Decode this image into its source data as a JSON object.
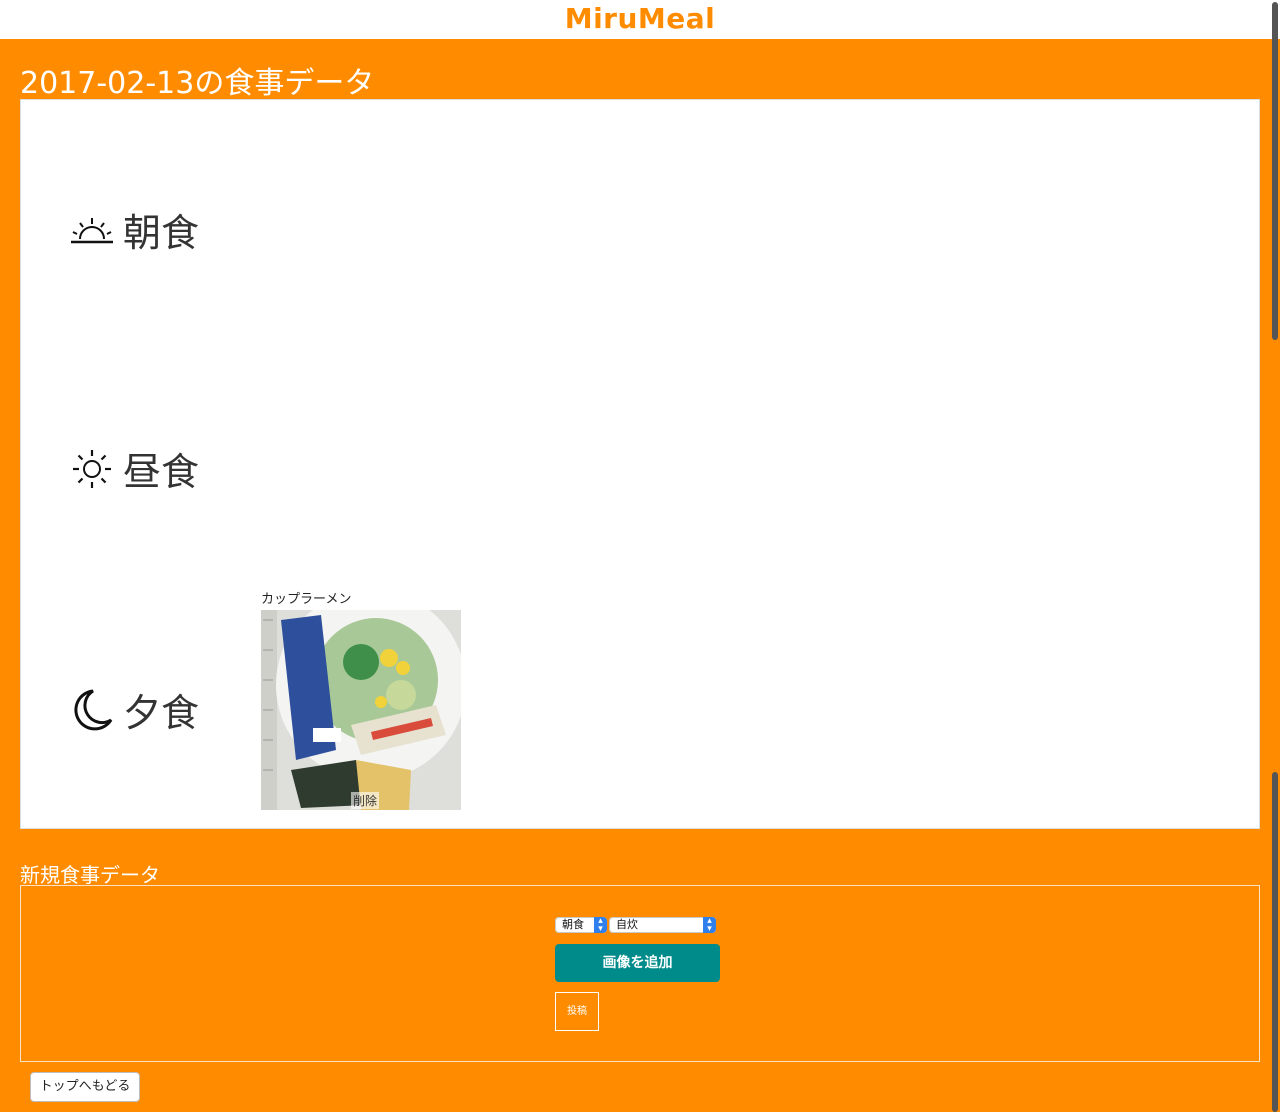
{
  "app": {
    "brand": "MiruMeal"
  },
  "page": {
    "title": "2017-02-13の食事データ"
  },
  "meals": [
    {
      "label": "朝食",
      "icon": "sunrise-icon"
    },
    {
      "label": "昼食",
      "icon": "sun-icon"
    },
    {
      "label": "夕食",
      "icon": "moon-icon"
    }
  ],
  "dinner_item": {
    "name": "カップラーメン",
    "delete_label": "削除"
  },
  "new_meal": {
    "title": "新規食事データ",
    "meal_select": {
      "value": "朝食"
    },
    "type_select": {
      "value": "自炊"
    },
    "add_image_label": "画像を追加",
    "post_label": "投稿"
  },
  "back_label": "トップへもどる",
  "colors": {
    "background": "#ff8c00",
    "brand": "#ff8c00",
    "button": "#008b8b"
  }
}
